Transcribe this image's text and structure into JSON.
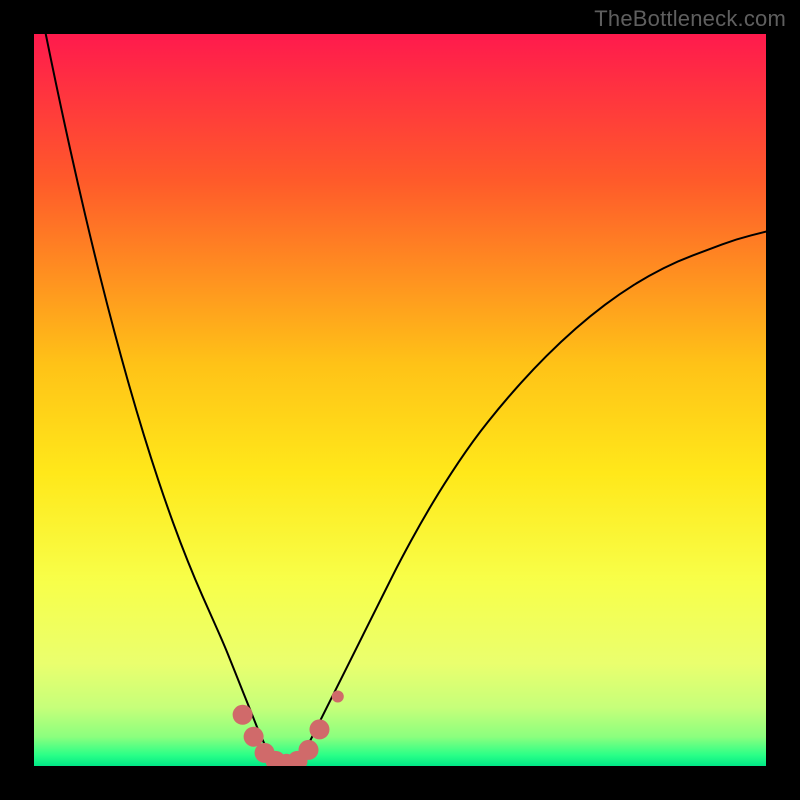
{
  "watermark": "TheBottleneck.com",
  "chart_data": {
    "type": "line",
    "title": "",
    "xlabel": "",
    "ylabel": "",
    "xlim": [
      0,
      100
    ],
    "ylim": [
      0,
      100
    ],
    "gradient_stops": [
      {
        "offset": 0.0,
        "color": "#ff1a4d"
      },
      {
        "offset": 0.2,
        "color": "#ff5a2a"
      },
      {
        "offset": 0.45,
        "color": "#ffc217"
      },
      {
        "offset": 0.6,
        "color": "#ffe81a"
      },
      {
        "offset": 0.75,
        "color": "#f7ff4a"
      },
      {
        "offset": 0.86,
        "color": "#eaff6e"
      },
      {
        "offset": 0.92,
        "color": "#c6ff7a"
      },
      {
        "offset": 0.96,
        "color": "#8cff7e"
      },
      {
        "offset": 0.985,
        "color": "#2bff87"
      },
      {
        "offset": 1.0,
        "color": "#00e886"
      }
    ],
    "series": [
      {
        "name": "bottleneck-curve",
        "color": "#000000",
        "stroke_width": 2,
        "x": [
          0.0,
          2.0,
          4.0,
          6.0,
          8.0,
          10.0,
          12.0,
          14.0,
          16.0,
          18.0,
          20.0,
          22.0,
          24.0,
          26.0,
          27.0,
          28.0,
          29.0,
          30.0,
          31.0,
          32.0,
          33.0,
          34.0,
          35.0,
          36.0,
          37.0,
          38.0,
          40.0,
          42.0,
          44.0,
          46.0,
          48.0,
          50.0,
          53.0,
          56.0,
          60.0,
          64.0,
          68.0,
          72.0,
          76.0,
          80.0,
          84.0,
          88.0,
          92.0,
          96.0,
          100.0
        ],
        "y": [
          108.0,
          98.0,
          88.5,
          79.5,
          71.0,
          63.0,
          55.5,
          48.5,
          42.0,
          36.0,
          30.5,
          25.5,
          21.0,
          16.5,
          14.0,
          11.5,
          9.0,
          6.5,
          4.0,
          2.0,
          0.7,
          0.0,
          0.0,
          0.5,
          2.0,
          4.0,
          8.0,
          12.0,
          16.0,
          20.0,
          24.0,
          28.0,
          33.5,
          38.5,
          44.5,
          49.5,
          54.0,
          58.0,
          61.5,
          64.5,
          67.0,
          69.0,
          70.5,
          72.0,
          73.0
        ]
      },
      {
        "name": "optimal-zone-markers",
        "color": "#d06a6a",
        "marker_radius_large": 10,
        "marker_radius_small": 6,
        "points": [
          {
            "x": 28.5,
            "y": 7.0,
            "r": "large"
          },
          {
            "x": 30.0,
            "y": 4.0,
            "r": "large"
          },
          {
            "x": 31.5,
            "y": 1.8,
            "r": "large"
          },
          {
            "x": 33.0,
            "y": 0.7,
            "r": "large"
          },
          {
            "x": 34.5,
            "y": 0.3,
            "r": "large"
          },
          {
            "x": 36.0,
            "y": 0.7,
            "r": "large"
          },
          {
            "x": 37.5,
            "y": 2.2,
            "r": "large"
          },
          {
            "x": 39.0,
            "y": 5.0,
            "r": "large"
          },
          {
            "x": 41.5,
            "y": 9.5,
            "r": "small"
          }
        ]
      }
    ]
  }
}
